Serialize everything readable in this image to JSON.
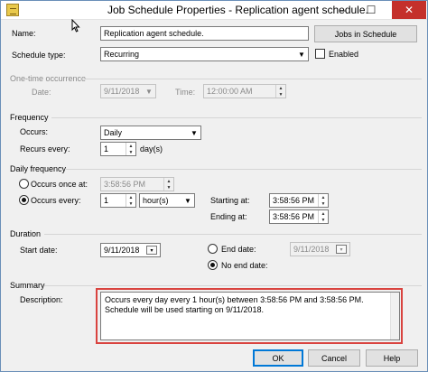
{
  "window": {
    "title": "Job Schedule Properties - Replication agent schedule.",
    "minimize": "–",
    "maximize": "☐",
    "close": "✕"
  },
  "name": {
    "label": "Name:",
    "value": "Replication agent schedule.",
    "jobs_button": "Jobs in Schedule"
  },
  "schedule_type": {
    "label": "Schedule type:",
    "value": "Recurring",
    "enabled_label": "Enabled",
    "enabled_checked": false
  },
  "one_time": {
    "title": "One-time occurrence",
    "date_label": "Date:",
    "date_value": "9/11/2018",
    "time_label": "Time:",
    "time_value": "12:00:00 AM"
  },
  "frequency": {
    "title": "Frequency",
    "occurs_label": "Occurs:",
    "occurs_value": "Daily",
    "recurs_label": "Recurs every:",
    "recurs_value": "1",
    "recurs_unit": "day(s)"
  },
  "daily_frequency": {
    "title": "Daily frequency",
    "once_label": "Occurs once at:",
    "once_value": "3:58:56 PM",
    "every_label": "Occurs every:",
    "every_value": "1",
    "every_unit": "hour(s)",
    "starting_label": "Starting at:",
    "starting_value": "3:58:56 PM",
    "ending_label": "Ending at:",
    "ending_value": "3:58:56 PM"
  },
  "duration": {
    "title": "Duration",
    "start_label": "Start date:",
    "start_value": "9/11/2018",
    "end_label": "End date:",
    "end_value": "9/11/2018",
    "no_end_label": "No end date:"
  },
  "summary": {
    "title": "Summary",
    "description_label": "Description:",
    "description": "Occurs every day every 1 hour(s) between 3:58:56 PM and 3:58:56 PM. Schedule will be used starting on 9/11/2018."
  },
  "buttons": {
    "ok": "OK",
    "cancel": "Cancel",
    "help": "Help"
  },
  "colors": {
    "highlight": "#d9433f",
    "close_button": "#c4302b"
  },
  "icons": {
    "app": "schedule-icon",
    "dropdown": "chevron-down-icon",
    "calendar": "calendar-icon"
  }
}
